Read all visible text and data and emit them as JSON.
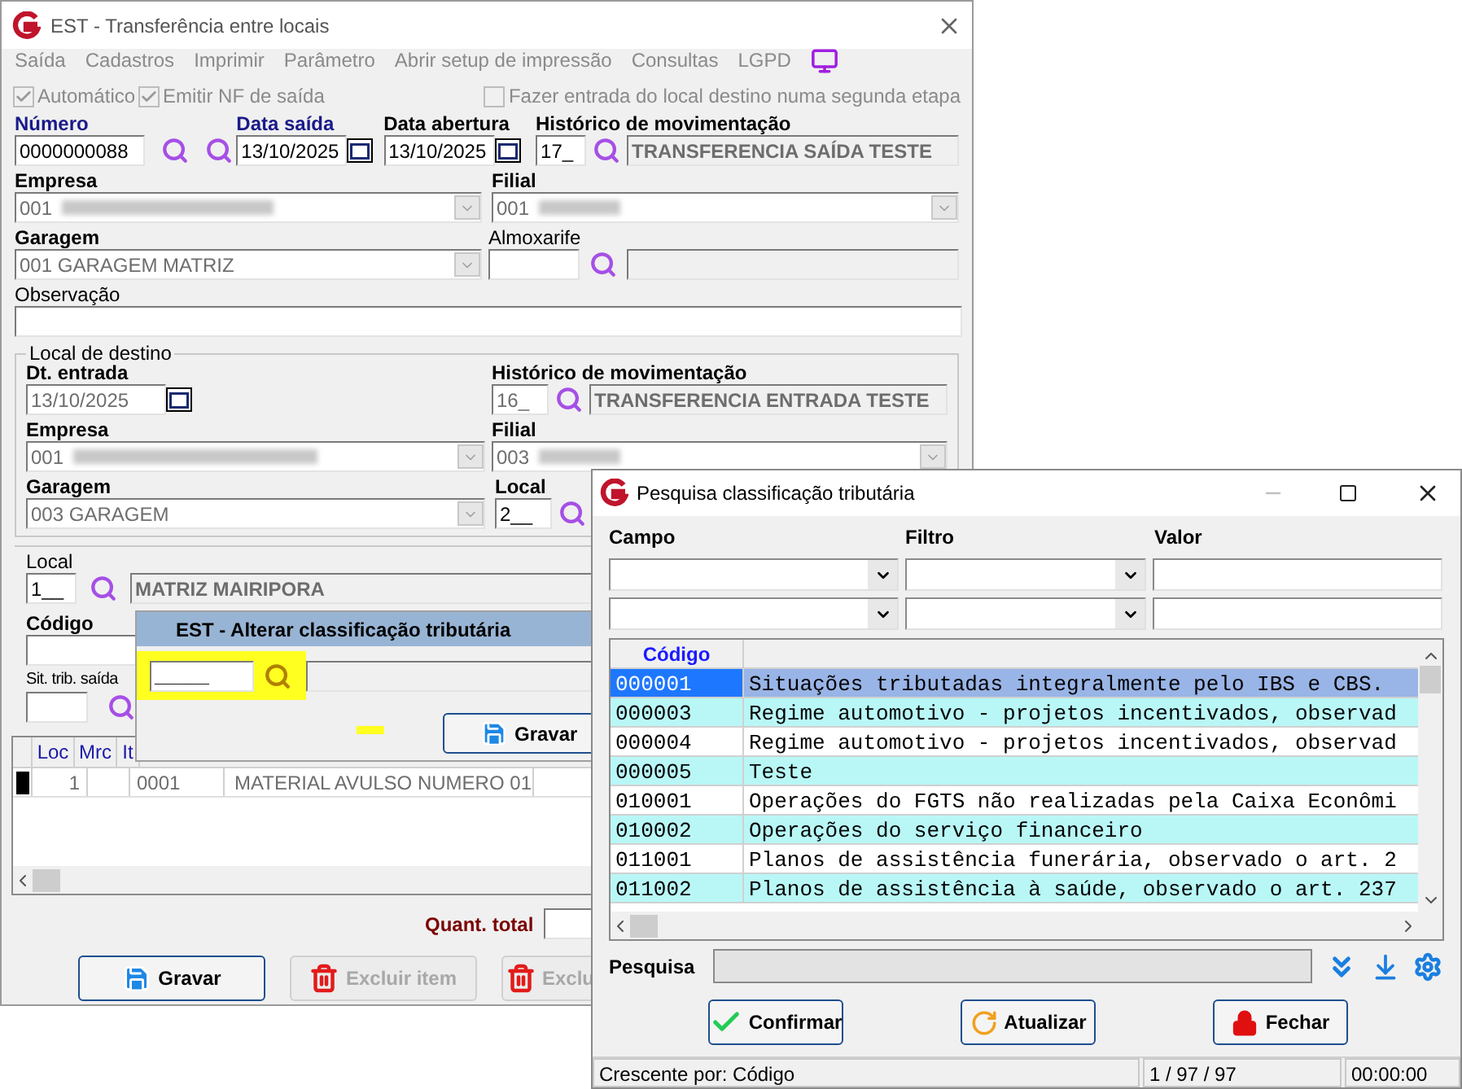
{
  "main_window": {
    "title": "EST - Transferência entre locais",
    "menu": [
      "Saída",
      "Cadastros",
      "Imprimir",
      "Parâmetro",
      "Abrir setup de impressão",
      "Consultas",
      "LGPD"
    ],
    "options": [
      {
        "label": "Automático",
        "checked": true
      },
      {
        "label": "Emitir NF de saída",
        "checked": true
      },
      {
        "label": "Fazer entrada do local destino numa segunda etapa",
        "checked": false
      }
    ],
    "numero": {
      "label": "Número",
      "value": "0000000088"
    },
    "data_saida": {
      "label": "Data saída",
      "value": "13/10/2025"
    },
    "data_abertura": {
      "label": "Data abertura",
      "value": "13/10/2025"
    },
    "historico": {
      "label": "Histórico de movimentação",
      "code": "17_",
      "description": "TRANSFERENCIA SAÍDA TESTE"
    },
    "empresa": {
      "label": "Empresa",
      "value": "001"
    },
    "filial": {
      "label": "Filial",
      "value": "001"
    },
    "garagem": {
      "label": "Garagem",
      "value": "001 GARAGEM MATRIZ"
    },
    "almoxarife": {
      "label": "Almoxarife"
    },
    "observacao": {
      "label": "Observação"
    },
    "destino": {
      "title": "Local de destino",
      "dt_entrada": {
        "label": "Dt. entrada",
        "value": "13/10/2025"
      },
      "historico": {
        "label": "Histórico de movimentação",
        "code": "16_",
        "description": "TRANSFERENCIA ENTRADA TESTE"
      },
      "empresa": {
        "label": "Empresa",
        "value": "001"
      },
      "filial": {
        "label": "Filial",
        "value": "003"
      },
      "garagem": {
        "label": "Garagem",
        "value": "003 GARAGEM"
      },
      "local": {
        "label": "Local",
        "code": "2__"
      }
    },
    "local": {
      "label": "Local",
      "code": "1__",
      "description": "MATRIZ MAIRIPORA"
    },
    "codigo": {
      "label": "Código"
    },
    "sit_trib": {
      "label": "Sit. trib. saída"
    },
    "items_table": {
      "columns": [
        "Loc",
        "Mrc",
        "It"
      ],
      "rows": [
        {
          "selected": true,
          "loc": "1",
          "item": "0001",
          "description": "MATERIAL AVULSO NUMERO 01"
        }
      ]
    },
    "quant_total": {
      "label": "Quant. total"
    },
    "buttons": [
      {
        "label": "Gravar",
        "kind": "save",
        "disabled": false
      },
      {
        "label": "Excluir item",
        "kind": "delete",
        "disabled": true
      },
      {
        "label": "Exclu",
        "kind": "delete",
        "disabled": true
      }
    ]
  },
  "alter_dialog": {
    "title": "EST - Alterar classificação tributária",
    "code": "_____",
    "button": "Gravar"
  },
  "search_dialog": {
    "title": "Pesquisa classificação tributária",
    "filter_labels": [
      "Campo",
      "Filtro",
      "Valor"
    ],
    "columns": [
      "Código"
    ],
    "rows": [
      {
        "code": "000001",
        "description": "Situações tributadas integralmente pelo IBS e CBS.",
        "selected": true
      },
      {
        "code": "000003",
        "description": "Regime automotivo - projetos incentivados, observad",
        "selected": false
      },
      {
        "code": "000004",
        "description": "Regime automotivo - projetos incentivados, observad",
        "selected": false
      },
      {
        "code": "000005",
        "description": "Teste",
        "selected": false
      },
      {
        "code": "010001",
        "description": "Operações do FGTS não realizadas pela Caixa Econômi",
        "selected": false
      },
      {
        "code": "010002",
        "description": "Operações do serviço financeiro",
        "selected": false
      },
      {
        "code": "011001",
        "description": "Planos de assistência funerária, observado o art. 2",
        "selected": false
      },
      {
        "code": "011002",
        "description": "Planos de assistência à saúde, observado o art. 237",
        "selected": false
      }
    ],
    "search_label": "Pesquisa",
    "buttons": [
      {
        "label": "Confirmar",
        "kind": "confirm"
      },
      {
        "label": "Atualizar",
        "kind": "refresh"
      },
      {
        "label": "Fechar",
        "kind": "close"
      }
    ],
    "status": {
      "sort": "Crescente por: Código",
      "count": "1 / 97 / 97",
      "time": "00:00:00"
    }
  }
}
